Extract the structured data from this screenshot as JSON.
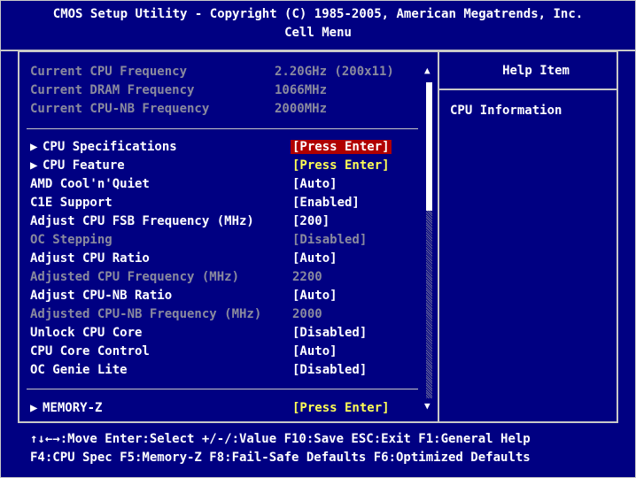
{
  "header": {
    "title": "CMOS Setup Utility - Copyright (C) 1985-2005, American Megatrends, Inc.",
    "subtitle": "Cell Menu"
  },
  "info": [
    {
      "label": "Current CPU Frequency",
      "value": "2.20GHz (200x11)"
    },
    {
      "label": "Current DRAM Frequency",
      "value": "1066MHz"
    },
    {
      "label": "Current CPU-NB Frequency",
      "value": "2000MHz"
    }
  ],
  "items": [
    {
      "label": "CPU Specifications",
      "value": "[Press Enter]",
      "submenu": true,
      "state": "selected"
    },
    {
      "label": "CPU Feature",
      "value": "[Press Enter]",
      "submenu": true,
      "state": "normal"
    },
    {
      "label": "AMD Cool'n'Quiet",
      "value": "[Auto]",
      "submenu": false,
      "state": "normal"
    },
    {
      "label": "C1E Support",
      "value": "[Enabled]",
      "submenu": false,
      "state": "normal"
    },
    {
      "label": "Adjust CPU FSB Frequency (MHz)",
      "value": "[200]",
      "submenu": false,
      "state": "normal"
    },
    {
      "label": "OC Stepping",
      "value": "[Disabled]",
      "submenu": false,
      "state": "disabled"
    },
    {
      "label": "Adjust CPU Ratio",
      "value": "[Auto]",
      "submenu": false,
      "state": "normal"
    },
    {
      "label": "Adjusted CPU Frequency (MHz)",
      "value": "2200",
      "submenu": false,
      "state": "disabled"
    },
    {
      "label": "Adjust CPU-NB Ratio",
      "value": "[Auto]",
      "submenu": false,
      "state": "normal"
    },
    {
      "label": "Adjusted CPU-NB Frequency (MHz)",
      "value": "2000",
      "submenu": false,
      "state": "disabled"
    },
    {
      "label": "Unlock CPU Core",
      "value": "[Disabled]",
      "submenu": false,
      "state": "normal"
    },
    {
      "label": "CPU Core Control",
      "value": "[Auto]",
      "submenu": false,
      "state": "normal"
    },
    {
      "label": "OC Genie Lite",
      "value": "[Disabled]",
      "submenu": false,
      "state": "normal"
    }
  ],
  "memory": {
    "label": "MEMORY-Z",
    "value": "[Press Enter]"
  },
  "help": {
    "title": "Help Item",
    "text": "CPU Information"
  },
  "footer": {
    "line1": "↑↓←→:Move  Enter:Select  +/-/:Value  F10:Save  ESC:Exit  F1:General Help",
    "line2": "F4:CPU Spec  F5:Memory-Z  F8:Fail-Safe Defaults    F6:Optimized Defaults"
  },
  "icons": {
    "submenu": "right-triangle-icon",
    "scroll_up": "up-triangle-icon",
    "scroll_down": "down-triangle-icon"
  },
  "colors": {
    "background": "#000082",
    "selected": "#b00000",
    "value": "#ffff55",
    "disabled": "#8a8a9e"
  }
}
